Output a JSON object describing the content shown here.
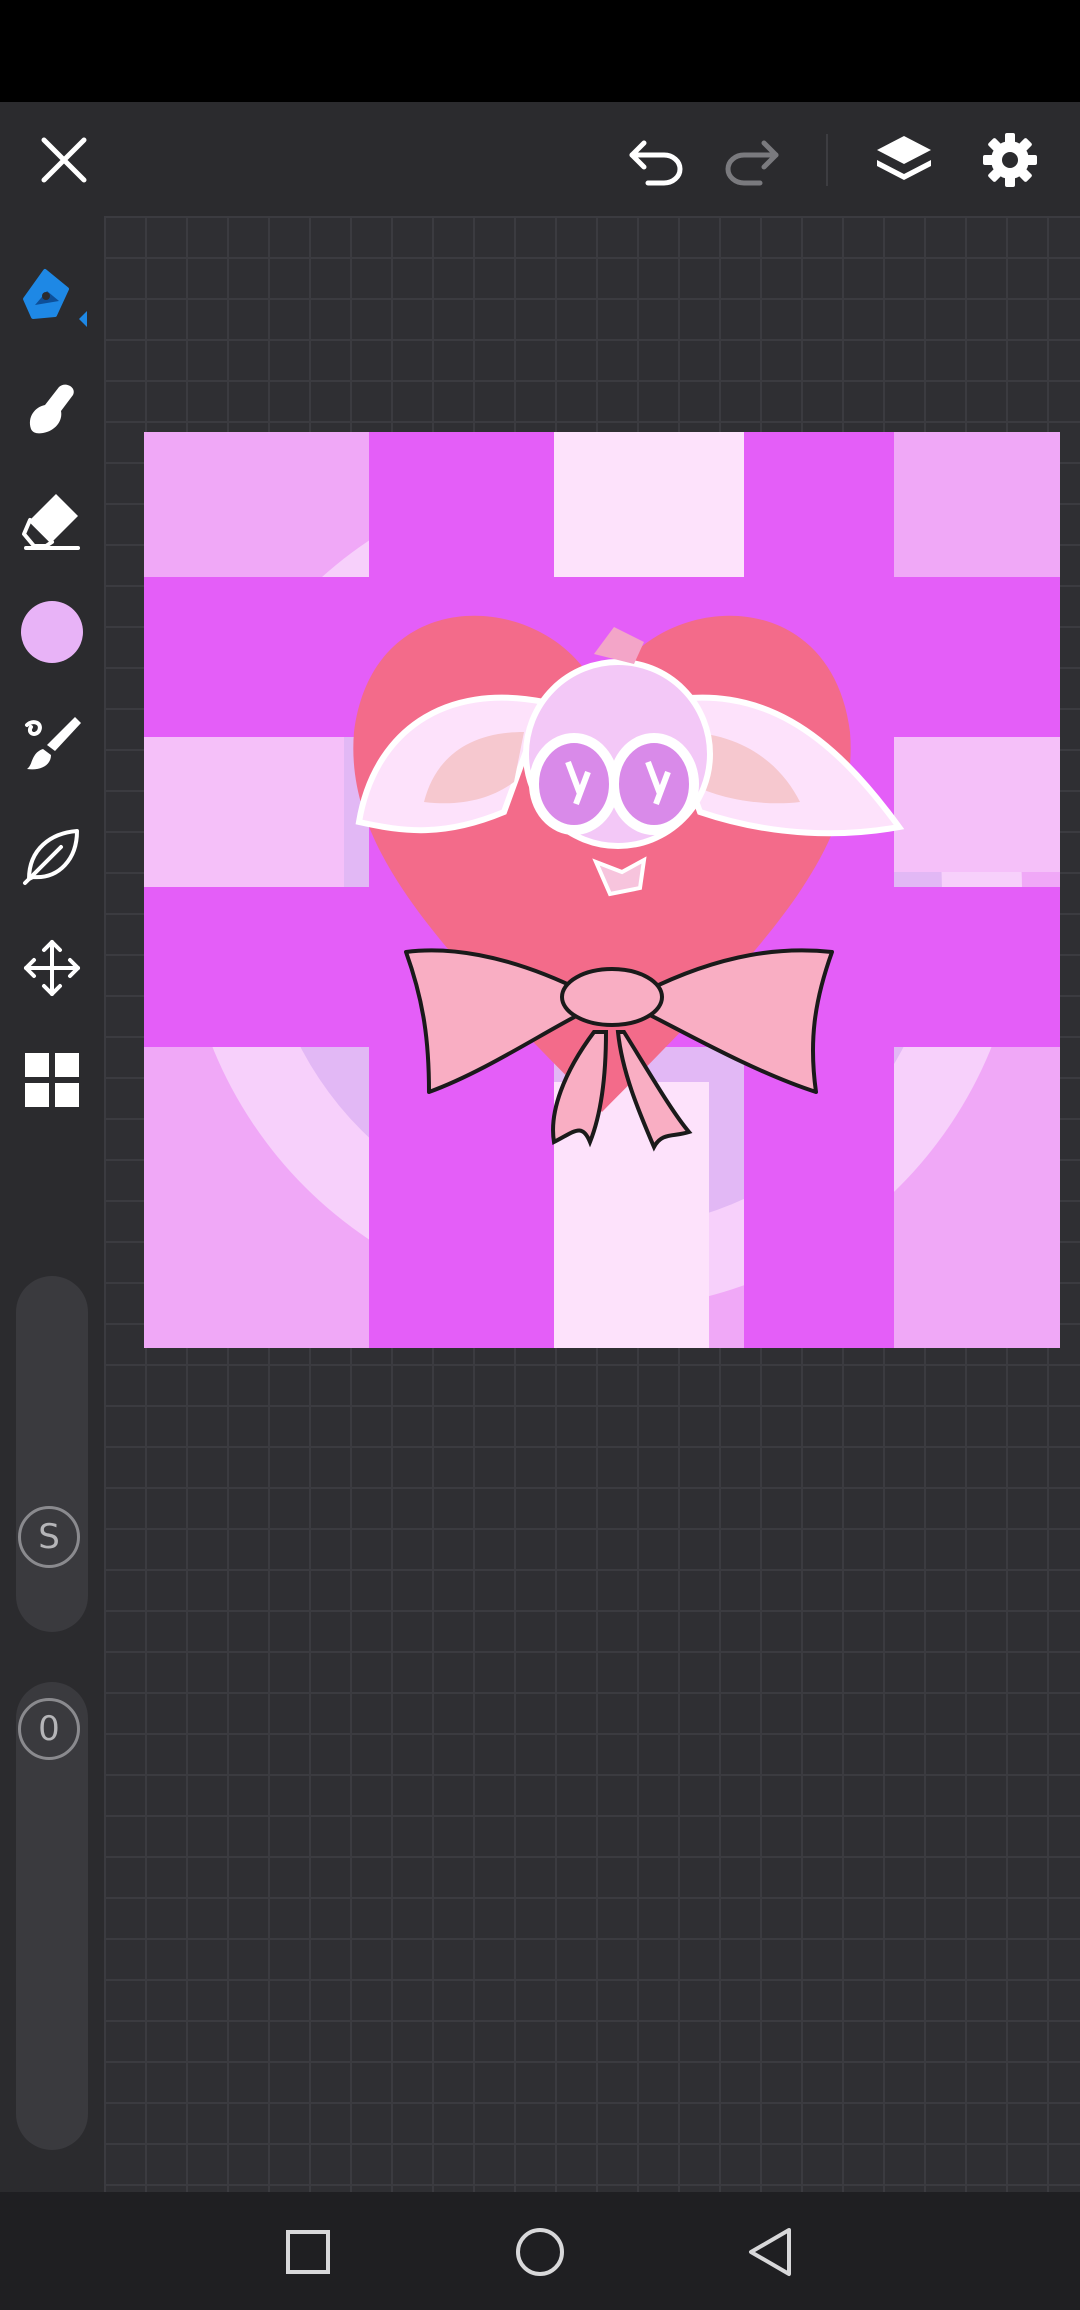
{
  "toolbar": {
    "close_icon": "close-icon",
    "undo_icon": "undo-icon",
    "redo_icon": "redo-icon",
    "layers_icon": "layers-icon",
    "settings_icon": "gear-icon"
  },
  "tools": [
    {
      "name": "pen",
      "icon": "pen-icon",
      "active": true
    },
    {
      "name": "smudge",
      "icon": "smudge-icon"
    },
    {
      "name": "eraser",
      "icon": "eraser-icon"
    },
    {
      "name": "color",
      "icon": "color-swatch",
      "color": "#e8b3f7"
    },
    {
      "name": "brush",
      "icon": "brush-icon"
    },
    {
      "name": "fill-lasso",
      "icon": "leaf-icon"
    },
    {
      "name": "transform",
      "icon": "move-icon"
    },
    {
      "name": "gallery",
      "icon": "grid-icon"
    }
  ],
  "sliders": {
    "size_label": "S",
    "opacity_label": "0"
  },
  "colors": {
    "accent": "#1e88e5",
    "canvas_bg": "#2f2f33",
    "ui_bg": "#2b2b2e"
  }
}
